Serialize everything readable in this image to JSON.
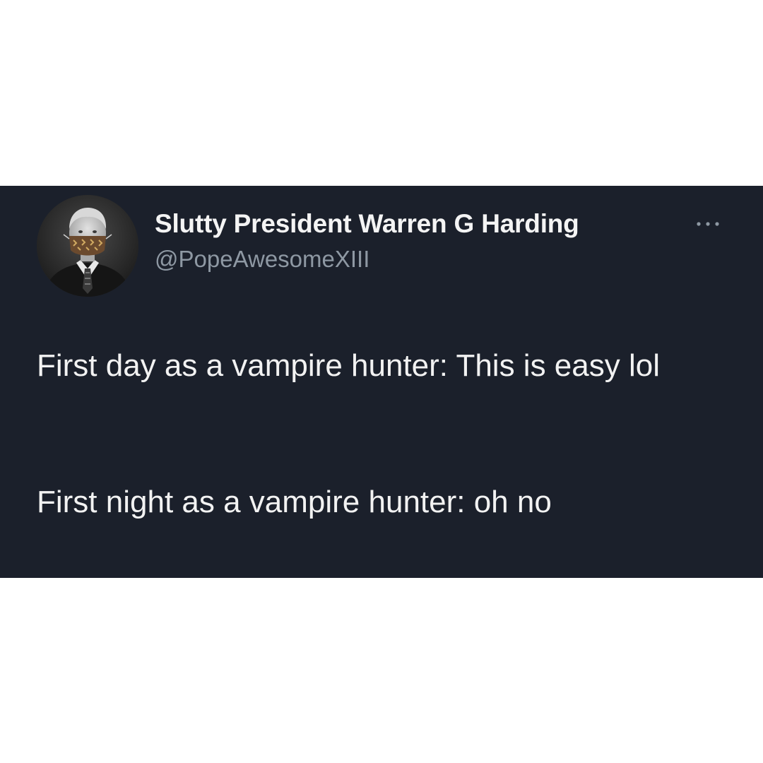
{
  "author": {
    "name": "Slutty President Warren G Harding",
    "handle": "@PopeAwesomeXIII",
    "avatar_icon": "profile-photo-masked-man"
  },
  "more_icon": "ellipsis-icon",
  "tweet": {
    "paragraph_1": "First day as a vampire hunter: This is easy lol",
    "paragraph_2": "First night as a vampire hunter: oh no"
  },
  "colors": {
    "page_background": "#ffffff",
    "card_background": "#1b202b",
    "primary_text": "#f2f2f2",
    "secondary_text": "#8e98a3"
  }
}
